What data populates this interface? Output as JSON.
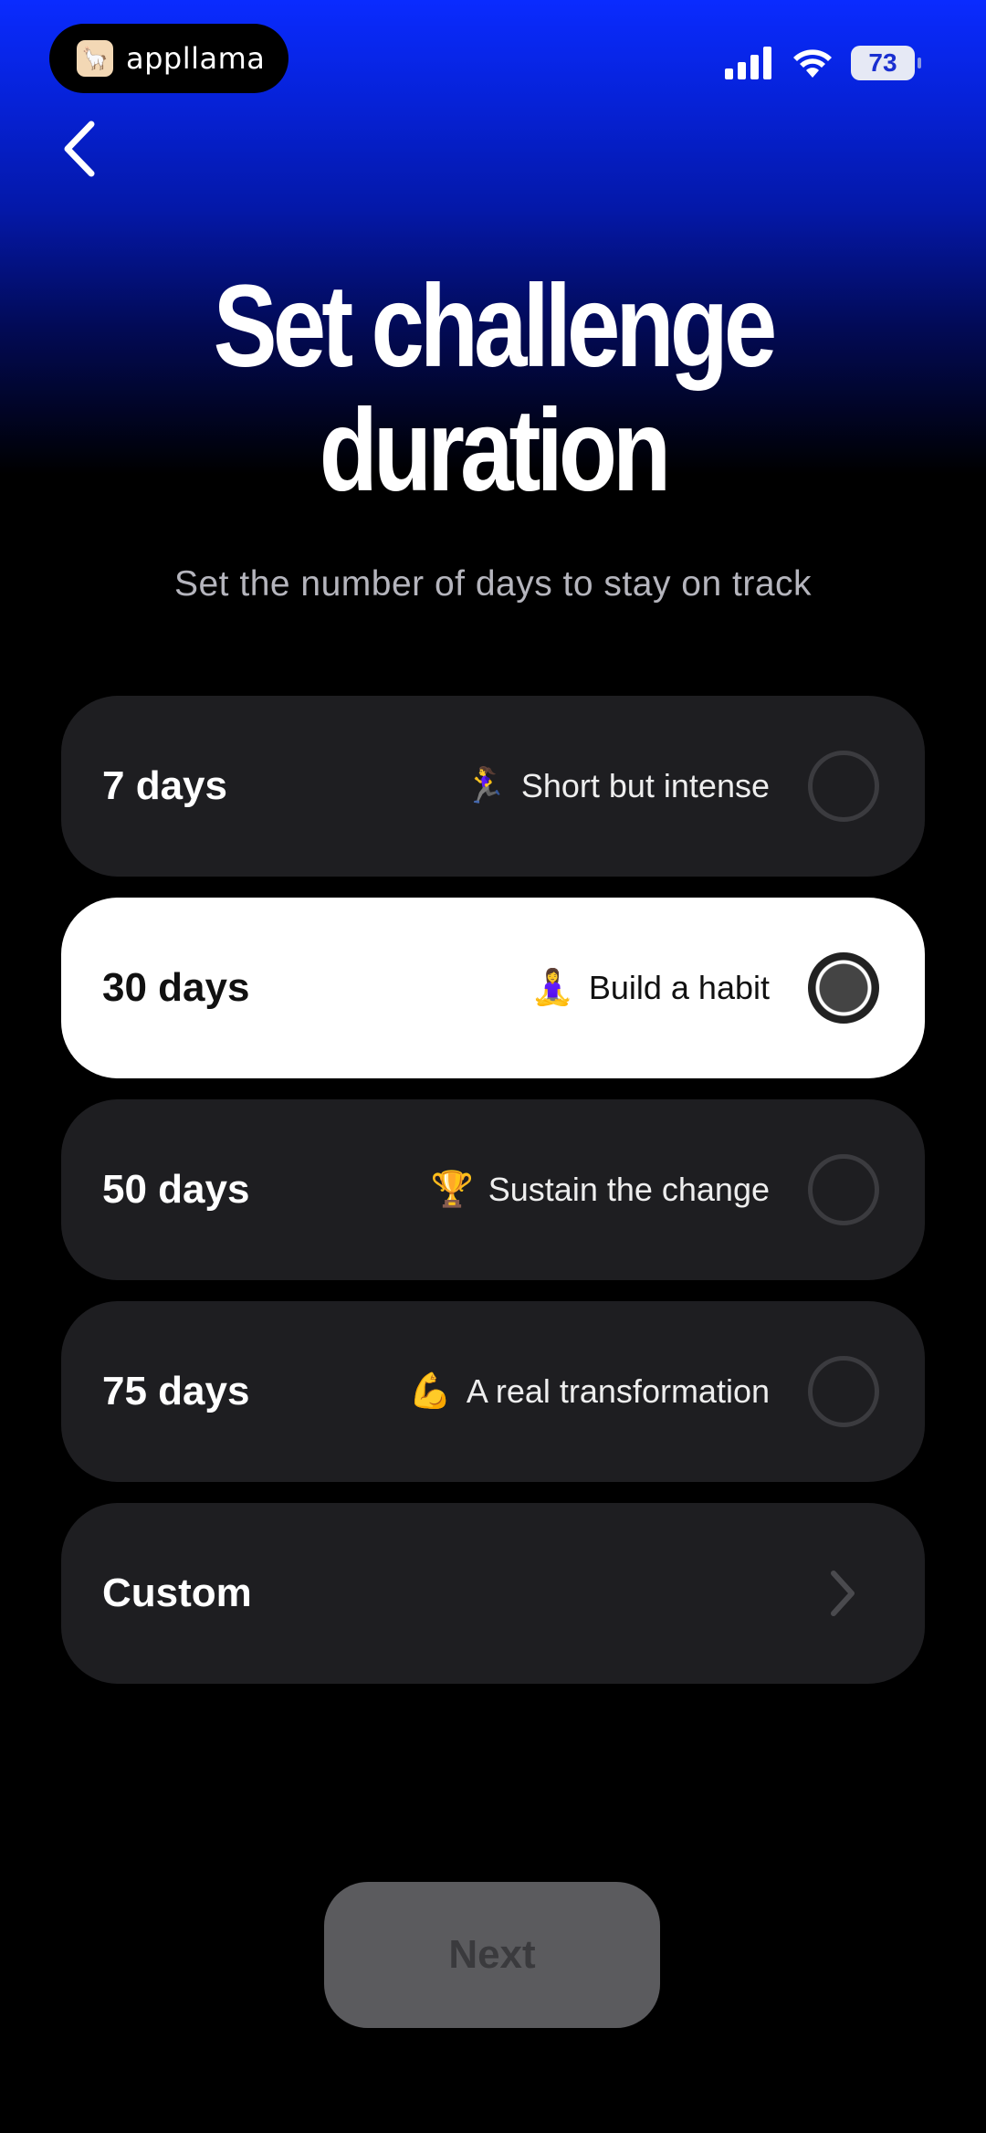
{
  "status_bar": {
    "app_pill_label": "appllama",
    "battery_level": "73"
  },
  "header": {
    "title_line1": "Set challenge",
    "title_line2": "duration",
    "subtitle": "Set the number of days to stay on track"
  },
  "options": [
    {
      "label": "7 days",
      "emoji": "🏃‍♀️",
      "description": "Short but intense",
      "selected": false
    },
    {
      "label": "30 days",
      "emoji": "🧘‍♀️",
      "description": "Build a habit",
      "selected": true
    },
    {
      "label": "50 days",
      "emoji": "🏆",
      "description": "Sustain the change",
      "selected": false
    },
    {
      "label": "75 days",
      "emoji": "💪",
      "description": "A real transformation",
      "selected": false
    }
  ],
  "custom": {
    "label": "Custom"
  },
  "footer": {
    "next_label": "Next"
  },
  "colors": {
    "gradient_top": "#0a2bff",
    "card_bg": "#1e1e21",
    "selected_bg": "#ffffff",
    "next_bg": "#5b5b5e"
  }
}
